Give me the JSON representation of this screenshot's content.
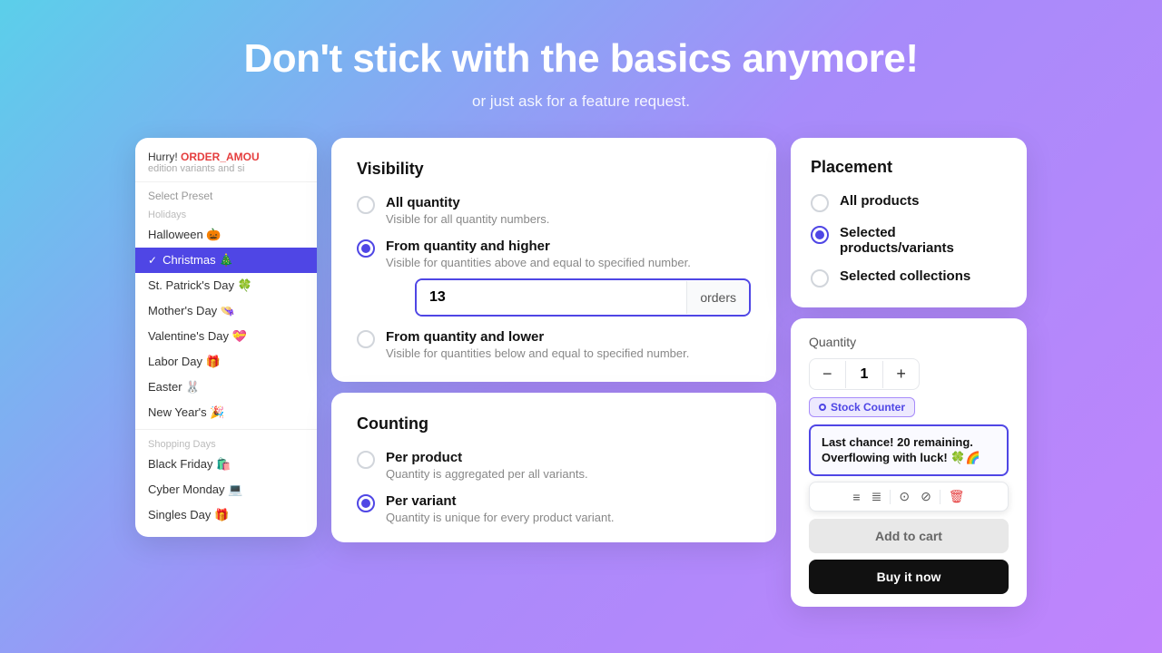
{
  "hero": {
    "heading": "Don't stick with the basics anymore!",
    "subtext": "or just ask for a feature request."
  },
  "preset": {
    "label": "Select Preset",
    "hurry_text": "Hurry! ORDER_AMOU",
    "hurry_span": "ORDER_AMOU",
    "hurry_sub": "edition variants and si",
    "sections": [
      {
        "label": "Holidays",
        "items": [
          {
            "name": "Halloween 🎃",
            "selected": false
          },
          {
            "name": "Christmas 🎄",
            "selected": true
          },
          {
            "name": "St. Patrick's Day 🍀",
            "selected": false
          },
          {
            "name": "Mother's Day 👒",
            "selected": false
          },
          {
            "name": "Valentine's Day 💝",
            "selected": false
          },
          {
            "name": "Labor Day 🎁",
            "selected": false
          },
          {
            "name": "Easter 🐰",
            "selected": false
          },
          {
            "name": "New Year's 🎉",
            "selected": false
          }
        ]
      },
      {
        "label": "Shopping Days",
        "items": [
          {
            "name": "Black Friday 🛍️",
            "selected": false
          },
          {
            "name": "Cyber Monday 💻",
            "selected": false
          },
          {
            "name": "Singles Day 🎁",
            "selected": false
          }
        ]
      }
    ]
  },
  "visibility": {
    "title": "Visibility",
    "options": [
      {
        "label": "All quantity",
        "desc": "Visible for all quantity numbers.",
        "checked": false
      },
      {
        "label": "From quantity and higher",
        "desc": "Visible for quantities above and equal to specified number.",
        "checked": true
      },
      {
        "label": "From quantity and lower",
        "desc": "Visible for quantities below and equal to specified number.",
        "checked": false
      }
    ],
    "quantity_value": "13",
    "quantity_unit": "orders"
  },
  "counting": {
    "title": "Counting",
    "options": [
      {
        "label": "Per product",
        "desc": "Quantity is aggregated per all variants.",
        "checked": false
      },
      {
        "label": "Per variant",
        "desc": "Quantity is unique for every product variant.",
        "checked": true
      }
    ]
  },
  "placement": {
    "title": "Placement",
    "options": [
      {
        "label": "All products",
        "checked": false
      },
      {
        "label": "Selected products/variants",
        "checked": true
      },
      {
        "label": "Selected collections",
        "checked": false
      }
    ]
  },
  "quantity_widget": {
    "label": "Quantity",
    "value": "1",
    "minus": "−",
    "plus": "+",
    "badge": "Stock Counter",
    "message_line1": "Last chance! 20 remaining.",
    "message_line2": "Overflowing with luck! 🍀🌈",
    "add_to_cart": "Add to cart",
    "buy_now": "Buy it now",
    "toolbar_icons": [
      "≡",
      "≣",
      "⊙",
      "⊘",
      "🗑"
    ]
  }
}
